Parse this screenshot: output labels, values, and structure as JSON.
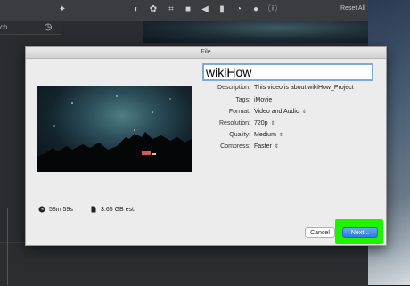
{
  "window": {
    "title": "File"
  },
  "toolbar": {
    "reset_all": "Reset All",
    "search_placeholder": "ch"
  },
  "project": {
    "name": "wikiHow"
  },
  "fields": [
    {
      "label": "Description:",
      "value": "This video is about wikiHow_Project",
      "stepper": false
    },
    {
      "label": "Tags:",
      "value": "iMovie",
      "stepper": false
    },
    {
      "label": "Format:",
      "value": "Video and Audio",
      "stepper": true
    },
    {
      "label": "Resolution:",
      "value": "720p",
      "stepper": true
    },
    {
      "label": "Quality:",
      "value": "Medium",
      "stepper": true
    },
    {
      "label": "Compress:",
      "value": "Faster",
      "stepper": true
    }
  ],
  "summary": {
    "duration": "58m 59s",
    "size": "3.65 GB est."
  },
  "buttons": {
    "cancel": "Cancel",
    "next": "Next..."
  },
  "colors": {
    "highlight": "#1ef300",
    "accent": "#3a82e6"
  }
}
